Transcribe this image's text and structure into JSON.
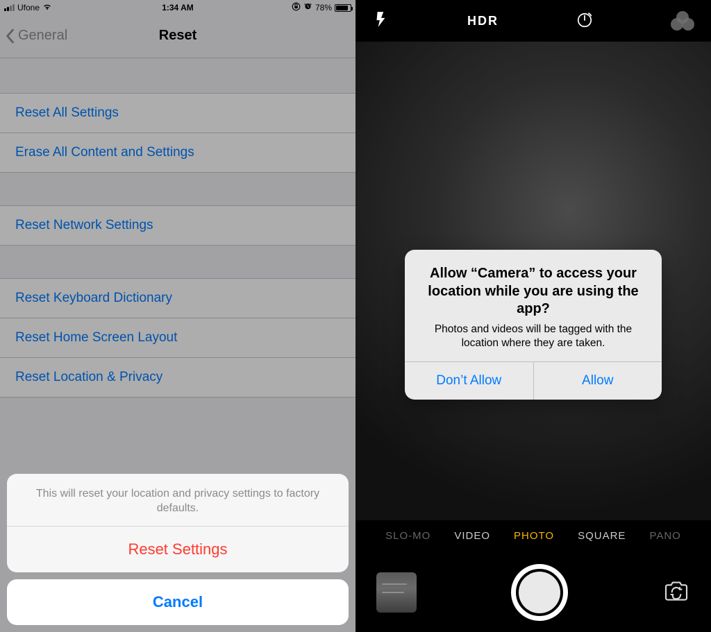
{
  "left": {
    "status": {
      "carrier": "Ufone",
      "time": "1:34 AM",
      "battery_pct": "78%"
    },
    "nav": {
      "back_label": "General",
      "title": "Reset"
    },
    "groups": [
      {
        "rows": [
          "Reset All Settings",
          "Erase All Content and Settings"
        ]
      },
      {
        "rows": [
          "Reset Network Settings"
        ]
      },
      {
        "rows": [
          "Reset Keyboard Dictionary",
          "Reset Home Screen Layout",
          "Reset Location & Privacy"
        ]
      }
    ],
    "action_sheet": {
      "message": "This will reset your location and privacy settings to factory defaults.",
      "destructive_label": "Reset Settings",
      "cancel_label": "Cancel"
    }
  },
  "right": {
    "top": {
      "hdr_label": "HDR"
    },
    "alert": {
      "title": "Allow “Camera” to access your location while you are using the app?",
      "subtitle": "Photos and videos will be tagged with the location where they are taken.",
      "deny_label": "Don’t Allow",
      "allow_label": "Allow"
    },
    "modes": {
      "items": [
        "SLO-MO",
        "VIDEO",
        "PHOTO",
        "SQUARE",
        "PANO"
      ],
      "active": "PHOTO"
    }
  }
}
